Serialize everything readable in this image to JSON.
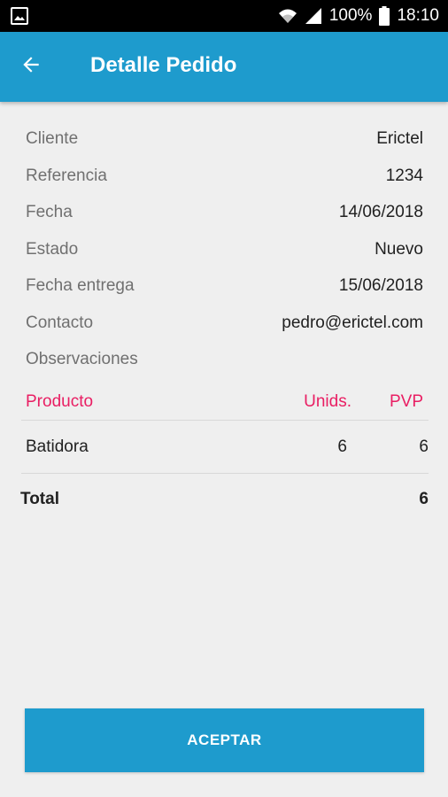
{
  "status_bar": {
    "battery": "100%",
    "time": "18:10",
    "icons": [
      "image-notification-icon",
      "wifi-icon",
      "signal-icon",
      "battery-icon"
    ]
  },
  "app_bar": {
    "title": "Detalle Pedido",
    "back_icon": "arrow-left-icon",
    "color": "#1e9bcd"
  },
  "details": [
    {
      "label": "Cliente",
      "value": "Erictel"
    },
    {
      "label": "Referencia",
      "value": "1234"
    },
    {
      "label": "Fecha",
      "value": "14/06/2018"
    },
    {
      "label": "Estado",
      "value": "Nuevo"
    },
    {
      "label": "Fecha entrega",
      "value": "15/06/2018"
    },
    {
      "label": "Contacto",
      "value": "pedro@erictel.com"
    },
    {
      "label": "Observaciones",
      "value": ""
    }
  ],
  "products": {
    "headers": [
      "Producto",
      "Unids.",
      "PVP"
    ],
    "header_color": "#e91e63",
    "rows": [
      {
        "producto": "Batidora",
        "unids": "6",
        "pvp": "6"
      }
    ],
    "total_label": "Total",
    "total_value": "6"
  },
  "actions": {
    "accept_label": "ACEPTAR"
  }
}
